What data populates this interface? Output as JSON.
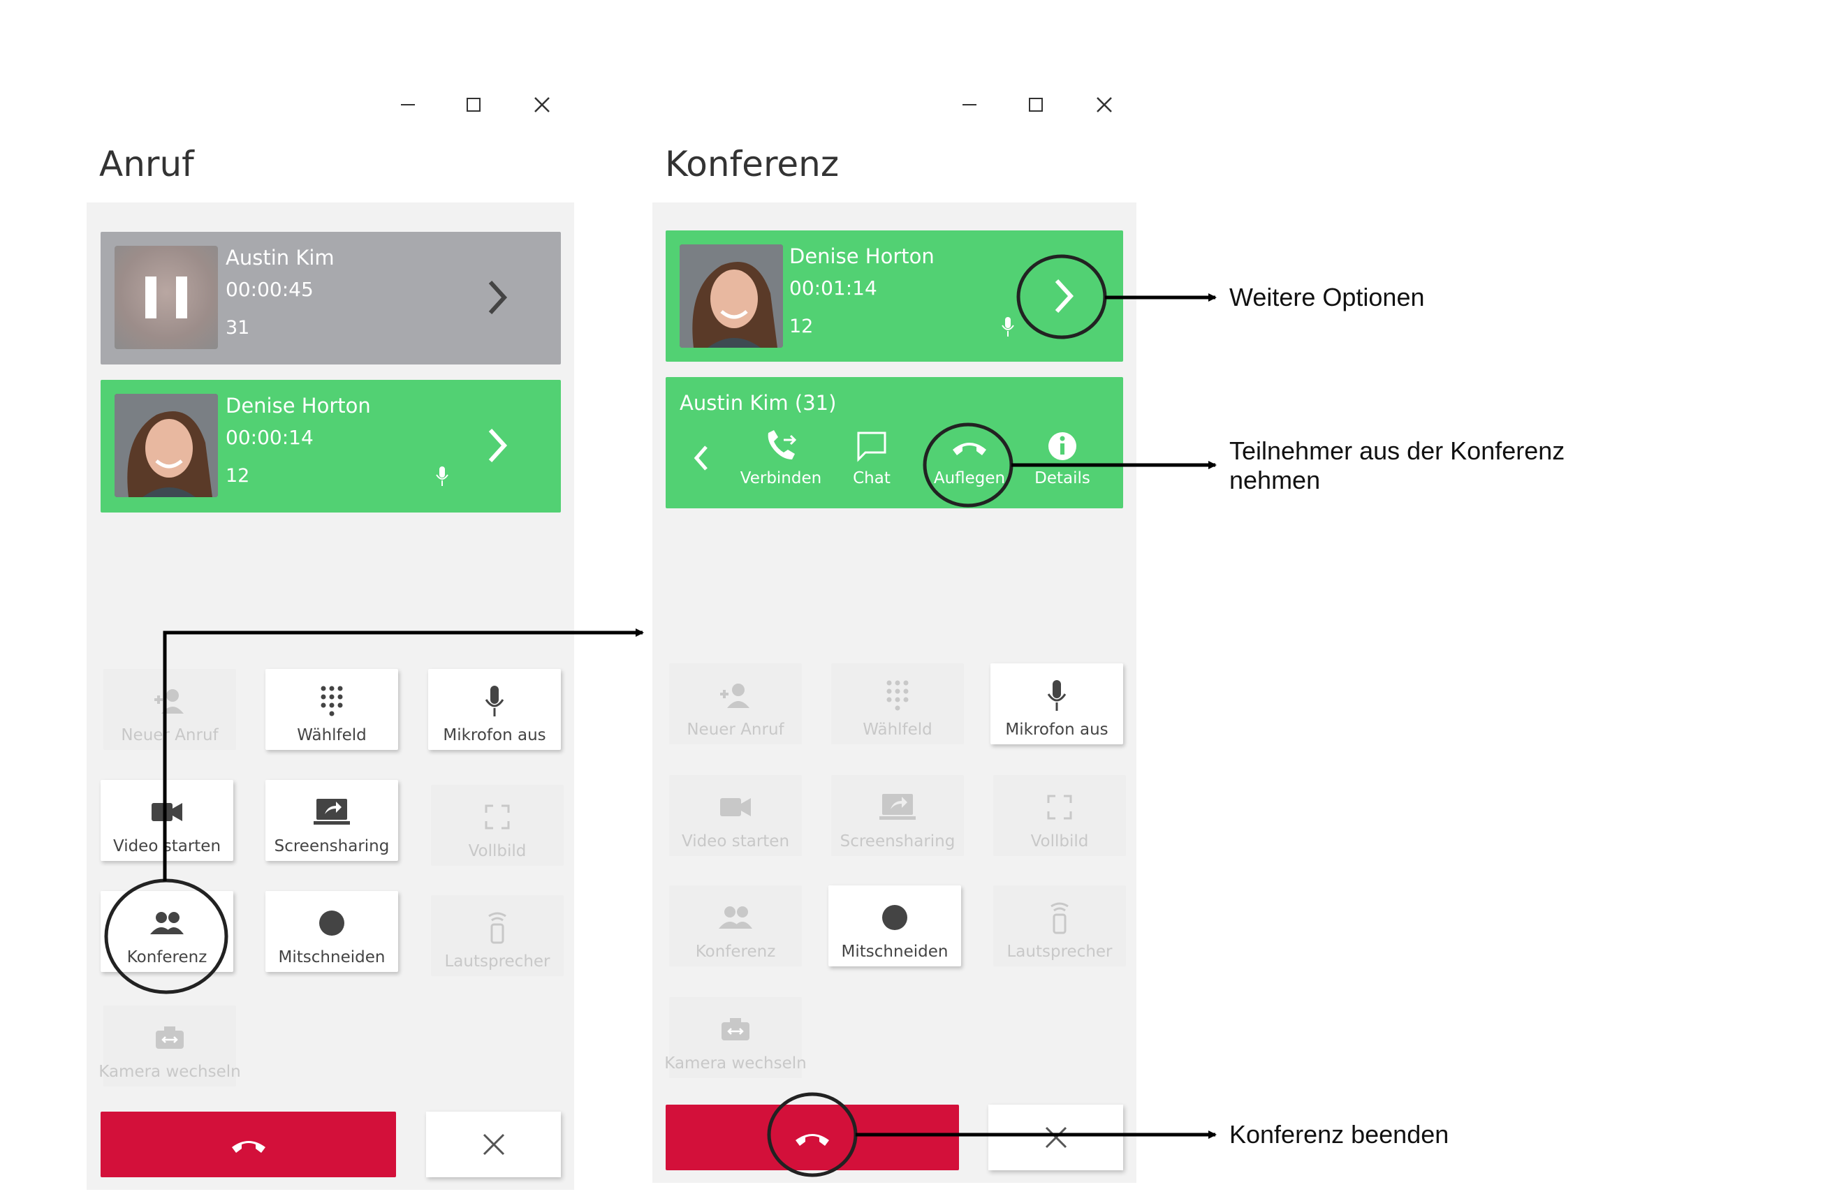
{
  "left_window": {
    "title": "Anruf",
    "controls": [
      "minimize",
      "maximize",
      "close"
    ],
    "calls": [
      {
        "name": "Austin Kim",
        "duration": "00:00:45",
        "number": "31",
        "state": "on-hold"
      },
      {
        "name": "Denise Horton",
        "duration": "00:00:14",
        "number": "12",
        "state": "active"
      }
    ],
    "buttons": [
      {
        "label": "Neuer Anruf",
        "icon": "add-user-icon",
        "enabled": false
      },
      {
        "label": "Wählfeld",
        "icon": "dialpad-icon",
        "enabled": true
      },
      {
        "label": "Mikrofon aus",
        "icon": "microphone-icon",
        "enabled": true
      },
      {
        "label": "Video starten",
        "icon": "video-icon",
        "enabled": true
      },
      {
        "label": "Screensharing",
        "icon": "screenshare-icon",
        "enabled": true
      },
      {
        "label": "Vollbild",
        "icon": "fullscreen-icon",
        "enabled": false
      },
      {
        "label": "Konferenz",
        "icon": "group-icon",
        "enabled": true
      },
      {
        "label": "Mitschneiden",
        "icon": "record-icon",
        "enabled": true
      },
      {
        "label": "Lautsprecher",
        "icon": "speaker-icon",
        "enabled": false
      },
      {
        "label": "Kamera wechseln",
        "icon": "switch-camera-icon",
        "enabled": false
      }
    ]
  },
  "right_window": {
    "title": "Konferenz",
    "controls": [
      "minimize",
      "maximize",
      "close"
    ],
    "call": {
      "name": "Denise Horton",
      "duration": "00:01:14",
      "number": "12"
    },
    "participant": {
      "title": "Austin Kim (31)",
      "actions": [
        {
          "label": "Verbinden",
          "icon": "transfer-call-icon"
        },
        {
          "label": "Chat",
          "icon": "chat-icon"
        },
        {
          "label": "Auflegen",
          "icon": "hangup-icon"
        },
        {
          "label": "Details",
          "icon": "info-icon"
        }
      ]
    },
    "buttons": [
      {
        "label": "Neuer Anruf",
        "icon": "add-user-icon",
        "enabled": false
      },
      {
        "label": "Wählfeld",
        "icon": "dialpad-icon",
        "enabled": false
      },
      {
        "label": "Mikrofon aus",
        "icon": "microphone-icon",
        "enabled": true
      },
      {
        "label": "Video starten",
        "icon": "video-icon",
        "enabled": false
      },
      {
        "label": "Screensharing",
        "icon": "screenshare-icon",
        "enabled": false
      },
      {
        "label": "Vollbild",
        "icon": "fullscreen-icon",
        "enabled": false
      },
      {
        "label": "Konferenz",
        "icon": "group-icon",
        "enabled": false
      },
      {
        "label": "Mitschneiden",
        "icon": "record-icon",
        "enabled": true
      },
      {
        "label": "Lautsprecher",
        "icon": "speaker-icon",
        "enabled": false
      },
      {
        "label": "Kamera wechseln",
        "icon": "switch-camera-icon",
        "enabled": false
      }
    ]
  },
  "annotations": {
    "more_options": "Weitere Optionen",
    "remove_participant_line1": "Teilnehmer aus der Konferenz",
    "remove_participant_line2": "nehmen",
    "end_conference": "Konferenz beenden"
  },
  "colors": {
    "active_call": "#52d173",
    "held_call": "#a8a9ad",
    "hangup": "#d3103a",
    "panel_bg": "#f2f2f2"
  }
}
